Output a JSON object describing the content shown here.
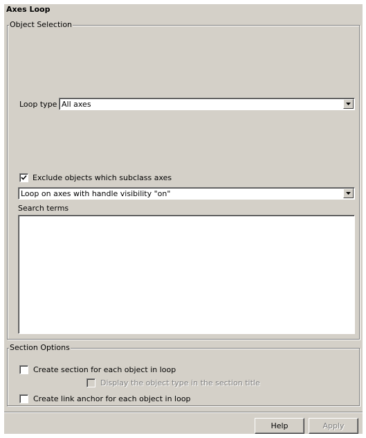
{
  "window": {
    "title": "Axes Loop"
  },
  "object_selection": {
    "group_label": "Object Selection",
    "loop_type_label": "Loop type",
    "loop_type_value": "All axes",
    "exclude_subclass": {
      "label": "Exclude objects which subclass axes",
      "checked": true
    },
    "handle_visibility_value": "Loop on axes with handle visibility \"on\"",
    "search_terms_label": "Search terms",
    "search_terms_value": ""
  },
  "section_options": {
    "group_label": "Section Options",
    "create_section": {
      "label": "Create section for each object in loop",
      "checked": false
    },
    "display_type": {
      "label": "Display the object type in the section title",
      "checked": false,
      "enabled": false
    },
    "create_anchor": {
      "label": "Create link anchor for each object in loop",
      "checked": false
    }
  },
  "buttons": {
    "help_label": "Help",
    "apply_label": "Apply"
  },
  "icons": {
    "dropdown": "chevron-down-icon",
    "check": "checkmark-icon"
  }
}
